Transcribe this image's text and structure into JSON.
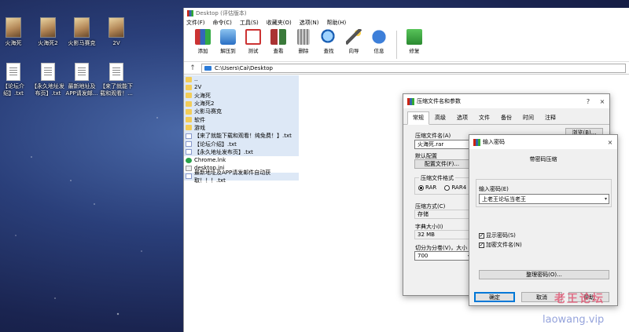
{
  "desktop": {
    "icons": [
      {
        "label": "火海死",
        "type": "image"
      },
      {
        "label": "火海死2",
        "type": "image"
      },
      {
        "label": "火影马赛克",
        "type": "image"
      },
      {
        "label": "2V",
        "type": "image"
      },
      {
        "label": "【论坛介绍】.txt",
        "type": "txt"
      },
      {
        "label": "【永久地址发布页】.txt",
        "type": "txt"
      },
      {
        "label": "最新地址及APP请发邮...",
        "type": "txt"
      },
      {
        "label": "【来了就能下载和观看！...",
        "type": "txt"
      }
    ]
  },
  "main_window": {
    "title": "Desktop (评估版本)",
    "menu": [
      "文件(F)",
      "命令(C)",
      "工具(S)",
      "收藏夹(O)",
      "选项(N)",
      "帮助(H)"
    ],
    "toolbar": [
      {
        "label": "添加",
        "icon": "add-archive-icon"
      },
      {
        "label": "解压到",
        "icon": "extract-icon"
      },
      {
        "label": "测试",
        "icon": "test-icon"
      },
      {
        "label": "查看",
        "icon": "view-icon"
      },
      {
        "label": "删除",
        "icon": "delete-icon"
      },
      {
        "label": "查找",
        "icon": "find-icon"
      },
      {
        "label": "向导",
        "icon": "wizard-icon"
      },
      {
        "label": "信息",
        "icon": "info-icon"
      },
      {
        "label": "修复",
        "icon": "repair-icon"
      }
    ],
    "path": "C:\\Users\\Cai\\Desktop",
    "files": [
      {
        "name": "..",
        "type": "folder"
      },
      {
        "name": "2V",
        "type": "folder"
      },
      {
        "name": "火海死",
        "type": "folder"
      },
      {
        "name": "火海死2",
        "type": "folder"
      },
      {
        "name": "火影马赛克",
        "type": "folder"
      },
      {
        "name": "软件",
        "type": "folder"
      },
      {
        "name": "游戏",
        "type": "folder"
      },
      {
        "name": "【来了就能下载和观看！纯免费！】.txt",
        "type": "txt"
      },
      {
        "name": "【论坛介绍】.txt",
        "type": "txt"
      },
      {
        "name": "【永久地址发布页】.txt",
        "type": "txt"
      },
      {
        "name": "Chrome.lnk",
        "type": "lnk"
      },
      {
        "name": "desktop.ini",
        "type": "ini"
      },
      {
        "name": "最新地址及APP请发邮件自动获取！！！.txt",
        "type": "txt"
      }
    ]
  },
  "archive_dialog": {
    "title": "压缩文件名和参数",
    "help": "?",
    "close": "×",
    "tabs": [
      "常规",
      "高级",
      "选项",
      "文件",
      "备份",
      "时间",
      "注释"
    ],
    "archive_name_label": "压缩文件名(A)",
    "archive_name_value": "火海死.rar",
    "browse_label": "浏览(B)...",
    "default_profile_label": "默认配置",
    "profiles_button": "配置文件(F)...",
    "format_label": "压缩文件格式",
    "formats": [
      "RAR",
      "RAR4"
    ],
    "method_label": "压缩方式(C)",
    "method_value": "存储",
    "dict_label": "字典大小(I)",
    "dict_value": "32 MB",
    "split_label": "切分为分卷(V)，大小",
    "split_value": "700"
  },
  "password_dialog": {
    "title": "输入密码",
    "close": "×",
    "heading": "带密码压缩",
    "password_label": "输入密码(E)",
    "password_value": "上老王论坛当老王",
    "show_password": "显示密码(S)",
    "encrypt_names": "加密文件名(N)",
    "organize_button": "整理密码(O)...",
    "ok_button": "确定",
    "cancel_button": "取消",
    "help_button": "帮助"
  },
  "watermark": {
    "line1": "老王论坛",
    "line2": "laowang.vip"
  }
}
